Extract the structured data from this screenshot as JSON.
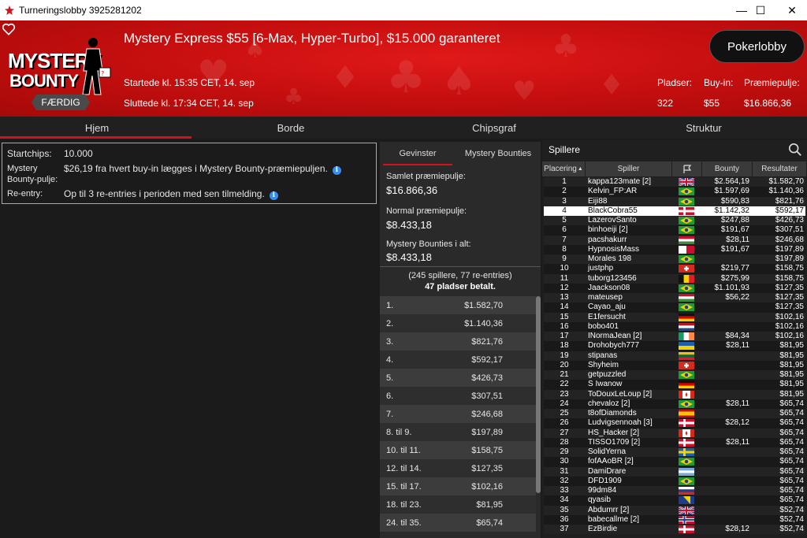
{
  "window": {
    "title": "Turneringslobby 3925281202",
    "minimize": "—",
    "maximize": "☐",
    "close": "✕"
  },
  "header": {
    "logo_line1": "MYSTERY",
    "logo_line2": "BOUNTY",
    "status_badge": "FÆRDIG",
    "title": "Mystery Express $55 [6-Max, Hyper-Turbo], $15.000 garanteret",
    "started": "Startede kl. 15:35 CET, 14. sep",
    "ended": "Sluttede kl. 17:34 CET, 14. sep",
    "lobby_button": "Pokerlobby",
    "stats": {
      "seats_label": "Pladser:",
      "seats_value": "322",
      "buyin_label": "Buy-in:",
      "buyin_value": "$55",
      "prizepool_label": "Præmiepulje:",
      "prizepool_value": "$16.866,36"
    }
  },
  "tabs": [
    "Hjem",
    "Borde",
    "Chipsgraf",
    "Struktur"
  ],
  "home": {
    "startchips_label": "Startchips:",
    "startchips_value": "10.000",
    "mystery_label1": "Mystery",
    "mystery_label2": "Bounty-pulje:",
    "mystery_value": "$26,19 fra hvert buy-in lægges i Mystery Bounty-præmiepuljen.",
    "reentry_label": "Re-entry:",
    "reentry_value": "Op til 3 re-entries i perioden med sen tilmelding.",
    "info_glyph": "i"
  },
  "prizes": {
    "tab_winnings": "Gevinster",
    "tab_bounties": "Mystery Bounties",
    "total_label": "Samlet præmiepulje:",
    "total_value": "$16.866,36",
    "normal_label": "Normal præmiepulje:",
    "normal_value": "$8.433,18",
    "bounties_label": "Mystery Bounties i alt:",
    "bounties_value": "$8.433,18",
    "players_info": "(245 spillere, 77 re-entries)",
    "paid_info": "47 pladser betalt.",
    "rows": [
      {
        "place": "1.",
        "amount": "$1.582,70"
      },
      {
        "place": "2.",
        "amount": "$1.140,36"
      },
      {
        "place": "3.",
        "amount": "$821,76"
      },
      {
        "place": "4.",
        "amount": "$592,17"
      },
      {
        "place": "5.",
        "amount": "$426,73"
      },
      {
        "place": "6.",
        "amount": "$307,51"
      },
      {
        "place": "7.",
        "amount": "$246,68"
      },
      {
        "place": "8. til 9.",
        "amount": "$197,89"
      },
      {
        "place": "10. til 11.",
        "amount": "$158,75"
      },
      {
        "place": "12. til 14.",
        "amount": "$127,35"
      },
      {
        "place": "15. til 17.",
        "amount": "$102,16"
      },
      {
        "place": "18. til 23.",
        "amount": "$81,95"
      },
      {
        "place": "24. til 35.",
        "amount": "$65,74"
      }
    ]
  },
  "players": {
    "heading": "Spillere",
    "columns": {
      "place": "Placering",
      "player": "Spiller",
      "bounty": "Bounty",
      "result": "Resultater"
    },
    "rows": [
      {
        "pos": "1",
        "name": "kappa123mate [2]",
        "flag": "gb",
        "bounty": "$2.564,19",
        "result": "$1.582,70"
      },
      {
        "pos": "2",
        "name": "Kelvin_FP:AR",
        "flag": "br",
        "bounty": "$1.597,69",
        "result": "$1.140,36"
      },
      {
        "pos": "3",
        "name": "Eiji88",
        "flag": "br",
        "bounty": "$590,83",
        "result": "$821,76"
      },
      {
        "pos": "4",
        "name": "BlackCobra55",
        "flag": "dk",
        "bounty": "$1.142,32",
        "result": "$592,17"
      },
      {
        "pos": "5",
        "name": "LazerovSanto",
        "flag": "br",
        "bounty": "$247,88",
        "result": "$426,73"
      },
      {
        "pos": "6",
        "name": "binhoeiji [2]",
        "flag": "br",
        "bounty": "$191,67",
        "result": "$307,51"
      },
      {
        "pos": "7",
        "name": "pacshakurr",
        "flag": "hu",
        "bounty": "$28,11",
        "result": "$246,68"
      },
      {
        "pos": "8",
        "name": "HypnosisMass",
        "flag": "mt",
        "bounty": "$191,67",
        "result": "$197,89"
      },
      {
        "pos": "9",
        "name": "Morales 198",
        "flag": "br",
        "bounty": "",
        "result": "$197,89"
      },
      {
        "pos": "10",
        "name": "justphp",
        "flag": "ch",
        "bounty": "$219,77",
        "result": "$158,75"
      },
      {
        "pos": "11",
        "name": "tuborg123456",
        "flag": "be",
        "bounty": "$275,99",
        "result": "$158,75"
      },
      {
        "pos": "12",
        "name": "Jaackson08",
        "flag": "br",
        "bounty": "$1.101,93",
        "result": "$127,35"
      },
      {
        "pos": "13",
        "name": "mateusep",
        "flag": "hu",
        "bounty": "$56,22",
        "result": "$127,35"
      },
      {
        "pos": "14",
        "name": "Cayao_aju",
        "flag": "br",
        "bounty": "",
        "result": "$127,35"
      },
      {
        "pos": "15",
        "name": "E1fersucht",
        "flag": "de",
        "bounty": "",
        "result": "$102,16"
      },
      {
        "pos": "16",
        "name": "bobo401",
        "flag": "nl",
        "bounty": "",
        "result": "$102,16"
      },
      {
        "pos": "17",
        "name": "INormaJean [2]",
        "flag": "ie",
        "bounty": "$84,34",
        "result": "$102,16"
      },
      {
        "pos": "18",
        "name": "Drohobych777",
        "flag": "ua",
        "bounty": "$28,11",
        "result": "$81,95"
      },
      {
        "pos": "19",
        "name": "stipanas",
        "flag": "lt",
        "bounty": "",
        "result": "$81,95"
      },
      {
        "pos": "20",
        "name": "Shyheim",
        "flag": "ch",
        "bounty": "",
        "result": "$81,95"
      },
      {
        "pos": "21",
        "name": "getpuzzled",
        "flag": "br",
        "bounty": "",
        "result": "$81,95"
      },
      {
        "pos": "22",
        "name": "S Iwanow",
        "flag": "de",
        "bounty": "",
        "result": "$81,95"
      },
      {
        "pos": "23",
        "name": "ToDouxLeLoup [2]",
        "flag": "ca",
        "bounty": "",
        "result": "$81,95"
      },
      {
        "pos": "24",
        "name": "chevaloz [2]",
        "flag": "br",
        "bounty": "$28,11",
        "result": "$65,74"
      },
      {
        "pos": "25",
        "name": "t8ofDiamonds",
        "flag": "es",
        "bounty": "",
        "result": "$65,74"
      },
      {
        "pos": "26",
        "name": "Ludvigsennoah [3]",
        "flag": "dk",
        "bounty": "$28,12",
        "result": "$65,74"
      },
      {
        "pos": "27",
        "name": "HS_Hacker [2]",
        "flag": "ca",
        "bounty": "",
        "result": "$65,74"
      },
      {
        "pos": "28",
        "name": "TISSO1709 [2]",
        "flag": "dk",
        "bounty": "$28,11",
        "result": "$65,74"
      },
      {
        "pos": "29",
        "name": "SolidYerna",
        "flag": "se",
        "bounty": "",
        "result": "$65,74"
      },
      {
        "pos": "30",
        "name": "fofAAoBR [2]",
        "flag": "br",
        "bounty": "",
        "result": "$65,74"
      },
      {
        "pos": "31",
        "name": "DamiDrare",
        "flag": "ar",
        "bounty": "",
        "result": "$65,74"
      },
      {
        "pos": "32",
        "name": "DFD1909",
        "flag": "br",
        "bounty": "",
        "result": "$65,74"
      },
      {
        "pos": "33",
        "name": "99dm84",
        "flag": "ru",
        "bounty": "",
        "result": "$65,74"
      },
      {
        "pos": "34",
        "name": "qyasib",
        "flag": "ba",
        "bounty": "",
        "result": "$65,74"
      },
      {
        "pos": "35",
        "name": "Abdumrr [2]",
        "flag": "gb",
        "bounty": "",
        "result": "$52,74"
      },
      {
        "pos": "36",
        "name": "babecallme [2]",
        "flag": "no",
        "bounty": "",
        "result": "$52,74"
      },
      {
        "pos": "37",
        "name": "EzBirdie",
        "flag": "dk",
        "bounty": "$28,12",
        "result": "$52,74"
      }
    ],
    "selected_index": 3
  },
  "colors": {
    "accent_red": "#d4121c",
    "header_red": "#c80f0f",
    "info_blue": "#3a8ee6",
    "panel_dark": "#1b1b1b"
  },
  "icons": [
    "pokerstars-logo-icon",
    "heart-icon",
    "info-icon",
    "search-icon",
    "flag-icon",
    "sort-icon"
  ]
}
